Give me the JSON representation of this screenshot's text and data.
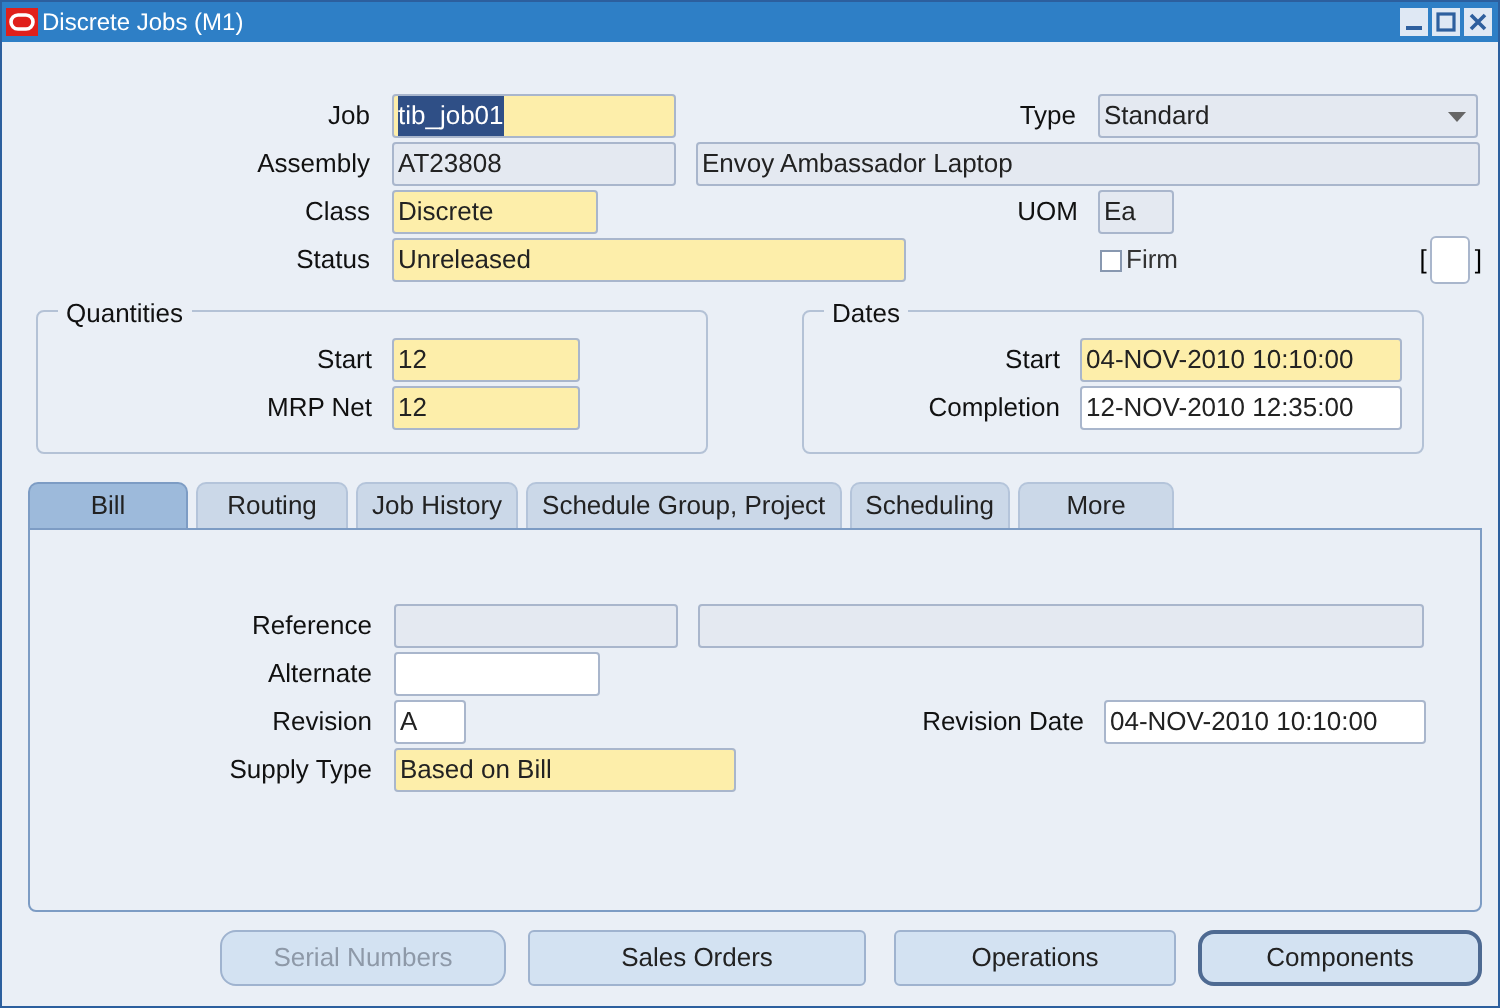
{
  "window": {
    "title": "Discrete Jobs (M1)"
  },
  "header": {
    "job": {
      "label": "Job",
      "value": "tib_job01",
      "kind": "required",
      "text_selected": true
    },
    "type": {
      "label": "Type",
      "value": "Standard",
      "kind": "list"
    },
    "assembly": {
      "label": "Assembly",
      "value": "AT23808",
      "kind": "readonly"
    },
    "assembly_description": {
      "value": "Envoy Ambassador Laptop",
      "kind": "readonly"
    },
    "class": {
      "label": "Class",
      "value": "Discrete",
      "kind": "required"
    },
    "uom": {
      "label": "UOM",
      "value": "Ea",
      "kind": "readonly"
    },
    "status": {
      "label": "Status",
      "value": "Unreleased",
      "kind": "required"
    },
    "firm": {
      "label": "Firm",
      "checked": false
    },
    "bracket": {
      "open": "[",
      "close": "]"
    }
  },
  "quantities": {
    "title": "Quantities",
    "fields": [
      {
        "label": "Start",
        "value": "12",
        "kind": "required"
      },
      {
        "label": "MRP Net",
        "value": "12",
        "kind": "required"
      }
    ]
  },
  "dates": {
    "title": "Dates",
    "fields": [
      {
        "label": "Start",
        "value": "04-NOV-2010 10:10:00",
        "kind": "required"
      },
      {
        "label": "Completion",
        "value": "12-NOV-2010 12:35:00",
        "kind": "normal"
      }
    ]
  },
  "tabs": [
    {
      "label": "Bill",
      "selected": true
    },
    {
      "label": "Routing",
      "selected": false
    },
    {
      "label": "Job History",
      "selected": false
    },
    {
      "label": "Schedule Group, Project",
      "selected": false
    },
    {
      "label": "Scheduling",
      "selected": false
    },
    {
      "label": "More",
      "selected": false
    }
  ],
  "bill": {
    "reference": {
      "label": "Reference",
      "kind": "readonly"
    },
    "reference_description": {
      "kind": "readonly"
    },
    "alternate": {
      "label": "Alternate",
      "kind": "normal"
    },
    "revision": {
      "label": "Revision",
      "value": "A",
      "kind": "normal"
    },
    "revision_date": {
      "label": "Revision Date",
      "value": "04-NOV-2010 10:10:00",
      "kind": "normal"
    },
    "supply_type": {
      "label": "Supply Type",
      "value": "Based on Bill",
      "kind": "required"
    }
  },
  "buttons": [
    {
      "label": "Serial Numbers",
      "disabled": true,
      "default": false
    },
    {
      "label": "Sales Orders",
      "disabled": false,
      "default": false
    },
    {
      "label": "Operations",
      "disabled": false,
      "default": false
    },
    {
      "label": "Components",
      "disabled": false,
      "default": true
    }
  ]
}
